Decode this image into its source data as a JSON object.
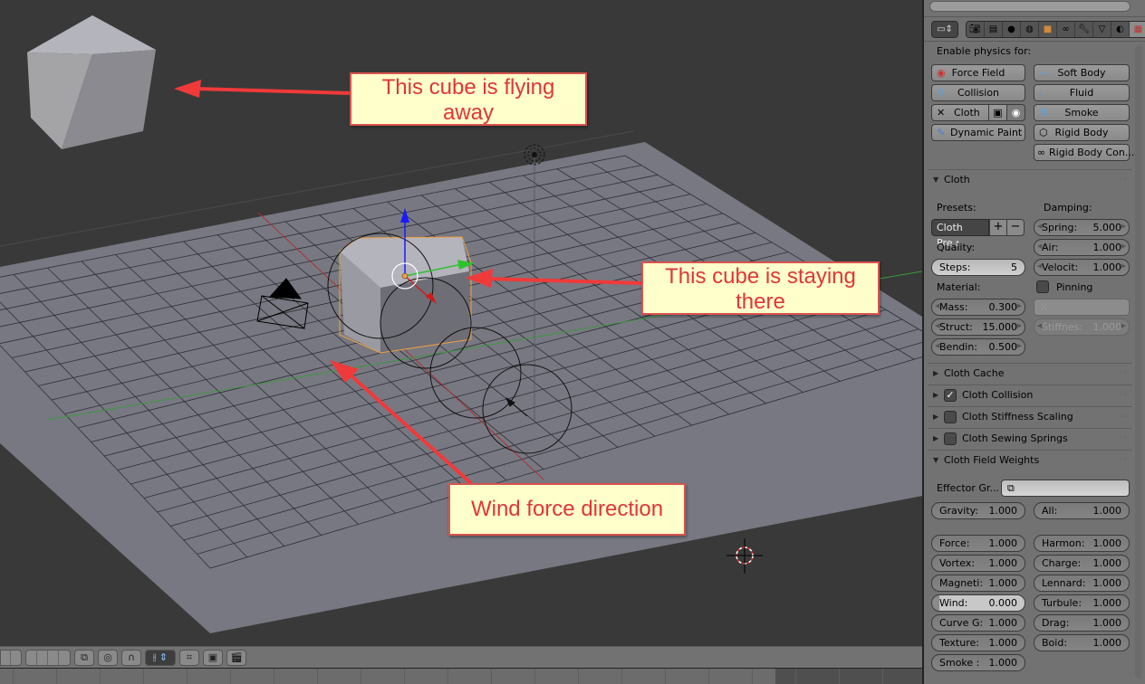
{
  "viewport": {
    "callouts": {
      "flying": "This cube is flying away",
      "flying_line1": "This cube is flying",
      "flying_line2": "away",
      "staying_line1": "This cube is staying",
      "staying_line2": "there",
      "wind": "Wind force direction"
    },
    "colors": {
      "background": "#393939",
      "plane": "#787882",
      "annotation_red": "#f03a3a",
      "callout_bg": "#ffffcc",
      "selected_outline": "#f0a040"
    }
  },
  "header_icons": [
    "layers-left",
    "layers-right",
    "object-data-icon",
    "proportional-edit-icon",
    "snap-magnet-icon",
    "snap-element-icon",
    "snap-target-icon",
    "render-camera-icon",
    "render-anim-icon"
  ],
  "properties": {
    "tabs": [
      "render-icon",
      "render-layers-icon",
      "scene-icon",
      "world-icon",
      "object-icon",
      "constraints-icon",
      "modifiers-icon",
      "data-icon",
      "material-icon",
      "texture-icon"
    ],
    "enable_physics_label": "Enable physics for:",
    "physics_buttons": {
      "force_field": "Force Field",
      "soft_body": "Soft Body",
      "collision": "Collision",
      "fluid": "Fluid",
      "cloth": "Cloth",
      "smoke": "Smoke",
      "dynamic_paint": "Dynamic Paint",
      "rigid_body": "Rigid Body",
      "rigid_body_con": "Rigid Body Con..."
    },
    "cloth": {
      "title": "Cloth",
      "presets_label": "Presets:",
      "preset_value": "Cloth Pre",
      "damping_label": "Damping:",
      "spring": {
        "label": "Spring:",
        "value": "5.000"
      },
      "air": {
        "label": "Air:",
        "value": "1.000"
      },
      "velocity": {
        "label": "Velocit:",
        "value": "1.000"
      },
      "quality_label": "Quality:",
      "steps": {
        "label": "Steps:",
        "value": "5"
      },
      "material_label": "Material:",
      "pinning_label": "Pinning",
      "mass": {
        "label": "Mass:",
        "value": "0.300"
      },
      "struct": {
        "label": "Struct:",
        "value": "15.000"
      },
      "bending": {
        "label": "Bendin:",
        "value": "0.500"
      },
      "stiffness": {
        "label": "Stiffnes:",
        "value": "1.000"
      }
    },
    "sections": [
      {
        "title": "Cloth Cache",
        "checkbox": null
      },
      {
        "title": "Cloth Collision",
        "checkbox": true
      },
      {
        "title": "Cloth Stiffness Scaling",
        "checkbox": false
      },
      {
        "title": "Cloth Sewing Springs",
        "checkbox": false
      }
    ],
    "field_weights": {
      "title": "Cloth Field Weights",
      "effector_label": "Effector Gr...",
      "gravity": {
        "label": "Gravity:",
        "value": "1.000"
      },
      "all": {
        "label": "All:",
        "value": "1.000"
      },
      "left": [
        {
          "label": "Force:",
          "value": "1.000"
        },
        {
          "label": "Vortex:",
          "value": "1.000"
        },
        {
          "label": "Magneti:",
          "value": "1.000"
        },
        {
          "label": "Wind:",
          "value": "0.000"
        },
        {
          "label": "Curve G:",
          "value": "1.000"
        },
        {
          "label": "Texture:",
          "value": "1.000"
        },
        {
          "label": "Smoke :",
          "value": "1.000"
        }
      ],
      "right": [
        {
          "label": "Harmon:",
          "value": "1.000"
        },
        {
          "label": "Charge:",
          "value": "1.000"
        },
        {
          "label": "Lennard:",
          "value": "1.000"
        },
        {
          "label": "Turbule:",
          "value": "1.000"
        },
        {
          "label": "Drag:",
          "value": "1.000"
        },
        {
          "label": "Boid:",
          "value": "1.000"
        }
      ]
    }
  }
}
